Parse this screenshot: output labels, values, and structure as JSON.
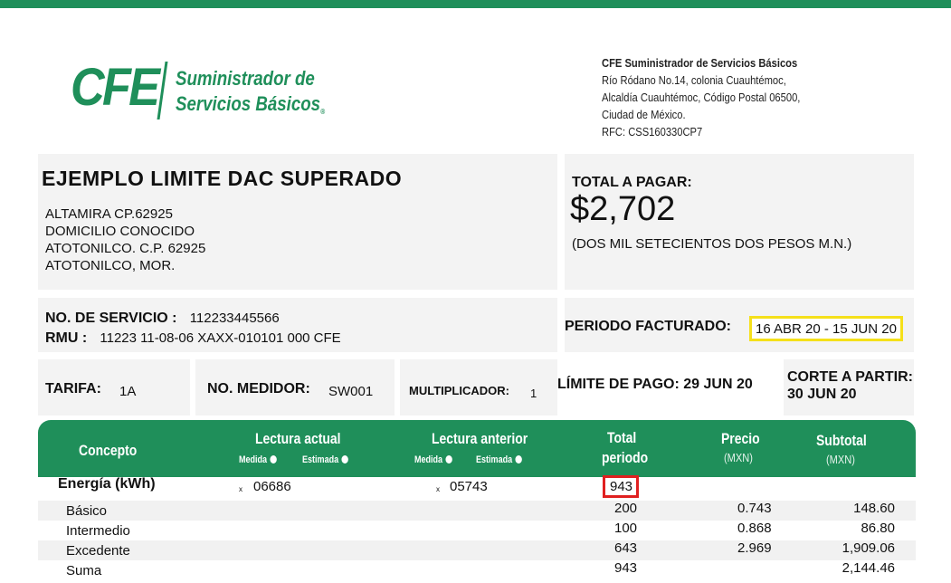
{
  "colors": {
    "brand_green": "#1f8f5a",
    "period_highlight": "#f5e01a",
    "total_highlight": "#e02020"
  },
  "logo": {
    "mark": "CFE",
    "line1": "Suministrador de",
    "line2": "Servicios Básicos",
    "registered": "®"
  },
  "company": {
    "name": "CFE Suministrador de Servicios Básicos",
    "address1": "Río Ródano No.14, colonia Cuauhtémoc,",
    "address2": "Alcaldía  Cuauhtémoc, Código Postal 06500,",
    "address3": "Ciudad de México.",
    "rfc": "RFC: CSS160330CP7"
  },
  "customer": {
    "title": "EJEMPLO LIMITE DAC SUPERADO",
    "line1": "ALTAMIRA CP.62925",
    "line2": "DOMICILIO CONOCIDO",
    "line3": "ATOTONILCO. C.P. 62925",
    "line4": "ATOTONILCO, MOR."
  },
  "total": {
    "label": "TOTAL A PAGAR:",
    "amount": "$2,702",
    "words": "(DOS MIL SETECIENTOS DOS PESOS  M.N.)"
  },
  "service": {
    "number_label": "NO. DE SERVICIO :",
    "number_value": "112233445566",
    "rmu_label": "RMU :",
    "rmu_value": "11223 11-08-06 XAXX-010101 000 CFE"
  },
  "period": {
    "label": "PERIODO FACTURADO:",
    "value": "16 ABR 20 - 15 JUN 20"
  },
  "tariff": {
    "label": "TARIFA:",
    "value": "1A"
  },
  "meter": {
    "label": "NO. MEDIDOR:",
    "value": "SW001"
  },
  "multiplier": {
    "label": "MULTIPLICADOR:",
    "value": "1"
  },
  "due": {
    "label": "LÍMITE DE PAGO: 29 JUN 20"
  },
  "cutoff": {
    "line1": "CORTE A PARTIR:",
    "line2": "30 JUN 20"
  },
  "table": {
    "headers": {
      "concepto": "Concepto",
      "lectura_actual": "Lectura actual",
      "lectura_anterior": "Lectura anterior",
      "medida": "Medida",
      "estimada": "Estimada",
      "total_periodo_1": "Total",
      "total_periodo_2": "periodo",
      "precio": "Precio",
      "precio_unit": "(MXN)",
      "subtotal": "Subtotal",
      "subtotal_unit": "(MXN)"
    },
    "energy": {
      "label": "Energía (kWh)",
      "marker": "x",
      "lectura_actual": "06686",
      "lectura_anterior": "05743",
      "total": "943"
    },
    "rows": [
      {
        "concept": "Básico",
        "total": "200",
        "price": "0.743",
        "subtotal": "148.60"
      },
      {
        "concept": "Intermedio",
        "total": "100",
        "price": "0.868",
        "subtotal": "86.80"
      },
      {
        "concept": "Excedente",
        "total": "643",
        "price": "2.969",
        "subtotal": "1,909.06"
      },
      {
        "concept": "Suma",
        "total": "943",
        "price": "",
        "subtotal": "2,144.46"
      }
    ]
  }
}
